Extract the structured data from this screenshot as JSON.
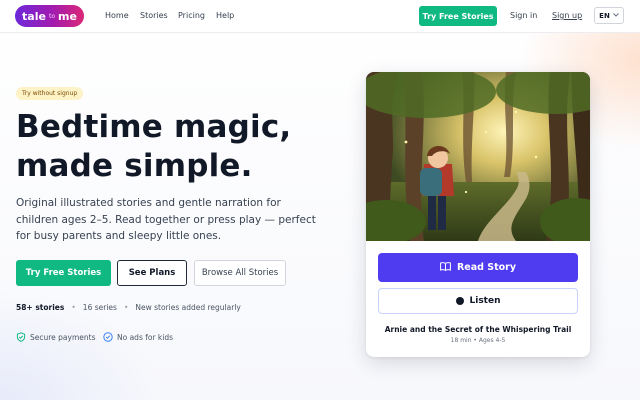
{
  "header": {
    "logo": {
      "part1": "tale",
      "part2": "to",
      "part3": "me"
    },
    "nav": [
      "Home",
      "Stories",
      "Pricing",
      "Help"
    ],
    "cta_label": "Try Free Stories",
    "signin_label": "Sign in",
    "signup_label": "Sign up",
    "language": "EN"
  },
  "hero": {
    "badge": "Try without signup",
    "headline_line1": "Bedtime magic,",
    "headline_line2": "made simple.",
    "subtitle": "Original illustrated stories and gentle narration for children ages 2–5. Read together or press play — perfect for busy parents and sleepy little ones.",
    "buttons": {
      "primary": "Try Free Stories",
      "secondary": "See Plans",
      "tertiary": "Browse All Stories"
    },
    "stats": {
      "stories": "58+ stories",
      "series": "16 series",
      "updates": "New stories added regularly"
    },
    "trust": {
      "payments": "Secure payments",
      "ads": "No ads for kids"
    }
  },
  "story_card": {
    "read_label": "Read Story",
    "listen_label": "Listen",
    "title": "Arnie and the Secret of the Whispering Trail",
    "meta": "18 min • Ages 4-5"
  },
  "colors": {
    "brand_green": "#10b981",
    "brand_purple": "#4f3cf0",
    "logo_gradient": [
      "#6d28d9",
      "#a21caf",
      "#db2777"
    ],
    "badge_bg": "#fef3c7"
  },
  "icons": {
    "read": "book-icon",
    "listen": "play-dot-icon",
    "payments": "shield-check-icon",
    "ads": "circle-check-icon",
    "language": "chevron-down-icon"
  }
}
